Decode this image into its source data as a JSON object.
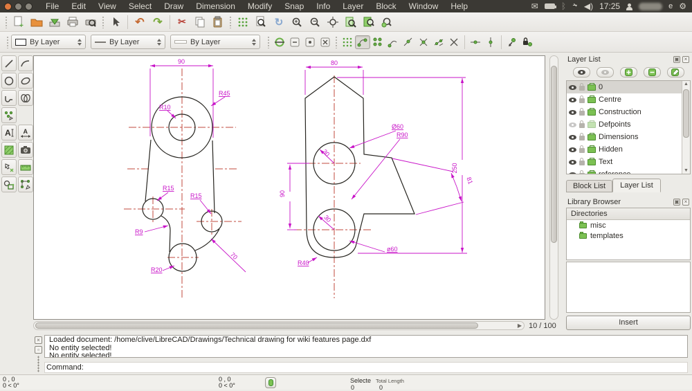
{
  "menubar": {
    "items": [
      "File",
      "Edit",
      "View",
      "Select",
      "Draw",
      "Dimension",
      "Modify",
      "Snap",
      "Info",
      "Layer",
      "Block",
      "Window",
      "Help"
    ],
    "clock": "17:25",
    "user_suffix": "e"
  },
  "toolbar1_icons": [
    "new-document",
    "open",
    "save",
    "print",
    "print-preview",
    "pointer",
    "undo",
    "redo",
    "cut",
    "copy",
    "paste",
    "grid-toggle",
    "zoom-page",
    "redraw",
    "zoom-in",
    "zoom-out",
    "zoom-auto",
    "zoom-previous",
    "zoom-window",
    "zoom-pan"
  ],
  "toolbar2": {
    "color_combo": "By Layer",
    "linetype_combo": "By Layer",
    "width_combo": "By Layer",
    "icons": [
      "pen-toggle",
      "hide-options",
      "dot-options",
      "close-options",
      "grid-snap",
      "snap-free",
      "snap-grid",
      "snap-endpoint",
      "snap-entity",
      "snap-middle",
      "snap-distance",
      "snap-intersection",
      "restrict-horizontal",
      "restrict-vertical",
      "set-relative-zero",
      "lock-relative-zero"
    ]
  },
  "lefttools_icons": [
    "line",
    "arc",
    "circle",
    "ellipse",
    "polyline",
    "spline",
    "points",
    "text",
    "dimension",
    "hatch",
    "image",
    "select",
    "measure",
    "block",
    "explode"
  ],
  "drawing": {
    "zoom_indicator": "10 / 100",
    "left": {
      "w": "90",
      "r45": "R45",
      "r10": "R10",
      "r15l": "R15",
      "r15r": "R15",
      "r9": "R9",
      "r20": "R20",
      "d70": "70"
    },
    "right": {
      "w": "80",
      "dia_top": "Ø60",
      "r90": "R90",
      "d250": "250",
      "d81": "81",
      "r30t": "30",
      "d90": "90",
      "r30b": "30",
      "dia_bot": "ø60",
      "r40": "R40"
    }
  },
  "layer_panel": {
    "title": "Layer List",
    "toolbar_icons": [
      "show-all-layers",
      "hide-all-layers",
      "add-layer",
      "remove-layer",
      "edit-layer"
    ],
    "items": [
      {
        "name": "0",
        "visible": true,
        "selected": true
      },
      {
        "name": "Centre",
        "visible": true
      },
      {
        "name": "Construction",
        "visible": true
      },
      {
        "name": "Defpoints",
        "visible": false
      },
      {
        "name": "Dimensions",
        "visible": true
      },
      {
        "name": "Hidden",
        "visible": true
      },
      {
        "name": "Text",
        "visible": true
      },
      {
        "name": "reference",
        "visible": true
      }
    ]
  },
  "tabs": {
    "block_list": "Block List",
    "layer_list": "Layer List"
  },
  "library": {
    "title": "Library Browser",
    "header": "Directories",
    "items": [
      "misc",
      "templates"
    ],
    "insert_label": "Insert"
  },
  "command": {
    "messages": [
      "Loaded document: /home/clive/LibreCAD/Drawings/Technical drawing for wiki features page.dxf",
      "No entity selected!",
      "No entity selected!"
    ],
    "prompt": "Command:"
  },
  "status": {
    "abs_coord": "0 , 0",
    "abs_angle": "0 < 0°",
    "rel_coord": "0 , 0",
    "rel_angle": "0 < 0°",
    "selected_label": "Selecte",
    "total_label": "Total Length",
    "selected_value": "0",
    "total_value": "0"
  },
  "colors": {
    "accent_green": "#61a644",
    "dim_magenta": "#c813c8",
    "centerline_red": "#c2493d",
    "panel_bg": "#ecebe7"
  }
}
